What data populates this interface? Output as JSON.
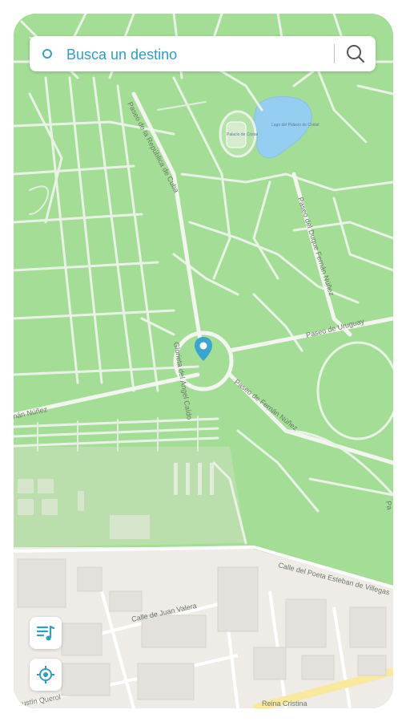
{
  "search": {
    "placeholder": "Busca un destino"
  },
  "map": {
    "labels": {
      "republica_cuba": "Paseo de la República de Cuba",
      "palacio_cristal": "Palacio de Cristal",
      "lago": "Lago del Palacio de Cristal",
      "duque_fernan_nunez": "Paseo del Duque Fernán Núñez",
      "uruguay": "Paseo de Uruguay",
      "angel_caido": "Glorieta del Ángel Caído",
      "fernan_nunez": "Paseo de Fernán Núñez",
      "nunez_left": "nán Núñez",
      "esteban_villegas": "Calle del Poeta Esteban de Villegas",
      "juan_valera": "Calle de Juan Valera",
      "agustin_querol": "Agustín Querol",
      "reina_cristina": "Reina Cristina",
      "right_edge": "Pa"
    }
  },
  "controls": {
    "layers": "playlist-icon",
    "locate": "locate-icon"
  },
  "colors": {
    "accent": "#2e9ec4",
    "park": "#8fd67f",
    "water": "#7fc4f0",
    "urban": "#ece8e2"
  }
}
